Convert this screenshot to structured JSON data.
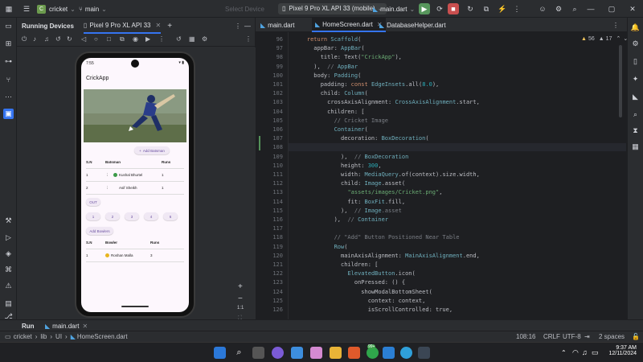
{
  "toolbar": {
    "project_badge": "C",
    "project_name": "cricket",
    "branch": "main",
    "select_device": "Select Device",
    "device": "Pixel 9 Pro XL API 33 (mobile)",
    "run_config": "main.dart"
  },
  "devices": {
    "title": "Running Devices",
    "device_tab": "Pixel 9 Pro XL API 33"
  },
  "app": {
    "status_time": "7:55",
    "title": "CrickApp",
    "add_batsman": "Add Batsman",
    "batsman_headers": [
      "S.N",
      "Batsman",
      "Runs"
    ],
    "batsman_rows": [
      {
        "sn": "1",
        "name": "Kushal Bhurtel",
        "runs": "1"
      },
      {
        "sn": "2",
        "name": "Asif Sheikh",
        "runs": "1"
      }
    ],
    "out_label": "OUT",
    "run_buttons": [
      "1",
      "2",
      "3",
      "4",
      "6"
    ],
    "add_bowlers": "Add Bowlers",
    "bowler_headers": [
      "S.N",
      "Bowler",
      "Runs"
    ],
    "bowler_rows": [
      {
        "sn": "1",
        "name": "Roshan Malla",
        "runs": "3"
      }
    ]
  },
  "zoom": {
    "ratio": "1:1"
  },
  "editor": {
    "tabs": [
      "main.dart",
      "HomeScreen.dart",
      "DatabaseHelper.dart"
    ],
    "warnings": "56",
    "weak_warnings": "17",
    "lines": [
      {
        "n": "96",
        "text": "    return Scaffold("
      },
      {
        "n": "97",
        "text": "      appBar: AppBar("
      },
      {
        "n": "98",
        "text": "        title: Text(\"CrickApp\"),"
      },
      {
        "n": "99",
        "text": "      ),  // AppBar"
      },
      {
        "n": "100",
        "text": "      body: Padding("
      },
      {
        "n": "101",
        "text": "        padding: const EdgeInsets.all(8.0),"
      },
      {
        "n": "102",
        "text": "        child: Column("
      },
      {
        "n": "103",
        "text": "          crossAxisAlignment: CrossAxisAlignment.start,"
      },
      {
        "n": "104",
        "text": "          children: ["
      },
      {
        "n": "105",
        "text": "            // Cricket Image"
      },
      {
        "n": "106",
        "text": "            Container("
      },
      {
        "n": "107",
        "text": "              decoration: BoxDecoration("
      },
      {
        "n": "108",
        "text": ""
      },
      {
        "n": "109",
        "text": "              ),  // BoxDecoration"
      },
      {
        "n": "110",
        "text": "              height: 300,"
      },
      {
        "n": "111",
        "text": "              width: MediaQuery.of(context).size.width,"
      },
      {
        "n": "112",
        "text": "              child: Image.asset("
      },
      {
        "n": "113",
        "text": "                \"assets/images/Cricket.png\","
      },
      {
        "n": "114",
        "text": "                fit: BoxFit.fill,"
      },
      {
        "n": "115",
        "text": "              ),  // Image.asset"
      },
      {
        "n": "116",
        "text": "            ),  // Container"
      },
      {
        "n": "117",
        "text": ""
      },
      {
        "n": "118",
        "text": "            // \"Add\" Button Positioned Near Table"
      },
      {
        "n": "119",
        "text": "            Row("
      },
      {
        "n": "120",
        "text": "              mainAxisAlignment: MainAxisAlignment.end,"
      },
      {
        "n": "121",
        "text": "              children: ["
      },
      {
        "n": "122",
        "text": "                ElevatedButton.icon("
      },
      {
        "n": "123",
        "text": "                  onPressed: () {"
      },
      {
        "n": "124",
        "text": "                    showModalBottomSheet("
      },
      {
        "n": "125",
        "text": "                      context: context,"
      },
      {
        "n": "126",
        "text": "                      isScrollControlled: true,"
      }
    ]
  },
  "run": {
    "label": "Run",
    "config": "main.dart"
  },
  "status": {
    "breadcrumb": [
      "cricket",
      "lib",
      "UI",
      "HomeScreen.dart"
    ],
    "position": "108:16",
    "line_ending": "CRLF",
    "encoding": "UTF-8",
    "indent": "2 spaces"
  },
  "taskbar": {
    "time": "9:37 AM",
    "date": "12/11/2024",
    "notification_count": "99+"
  }
}
